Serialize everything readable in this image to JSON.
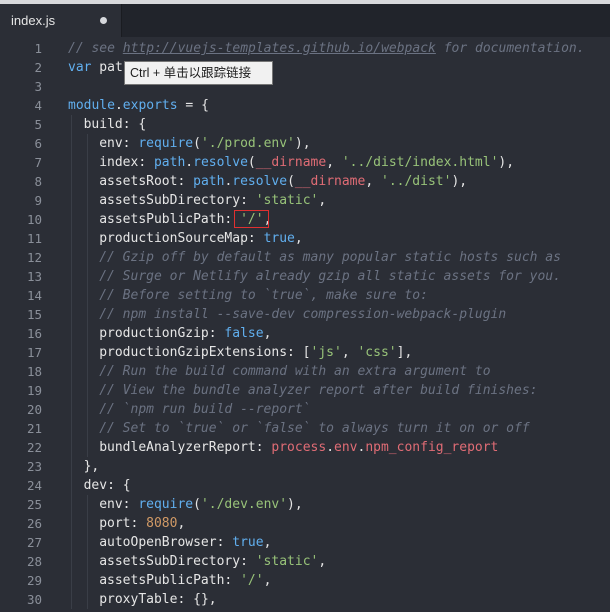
{
  "tab": {
    "title": "index.js",
    "modified": true
  },
  "tooltip": {
    "text": "Ctrl + 单击以跟踪链接"
  },
  "lines": [
    {
      "n": 1,
      "indent": 0,
      "tokens": [
        {
          "c": "cmt",
          "t": "// see "
        },
        {
          "c": "link",
          "t": "http://vuejs-templates.github.io/webpack"
        },
        {
          "c": "cmt",
          "t": " for documentation."
        }
      ]
    },
    {
      "n": 2,
      "indent": 0,
      "tokens": [
        {
          "c": "kw",
          "t": "var"
        },
        {
          "c": "id",
          "t": " pat"
        }
      ]
    },
    {
      "n": 3,
      "indent": 0,
      "tokens": []
    },
    {
      "n": 4,
      "indent": 0,
      "tokens": [
        {
          "c": "kw",
          "t": "module"
        },
        {
          "c": "id",
          "t": "."
        },
        {
          "c": "kw",
          "t": "exports"
        },
        {
          "c": "id",
          "t": " = {"
        }
      ]
    },
    {
      "n": 5,
      "indent": 1,
      "tokens": [
        {
          "c": "prop",
          "t": "build"
        },
        {
          "c": "id",
          "t": ": {"
        }
      ]
    },
    {
      "n": 6,
      "indent": 2,
      "tokens": [
        {
          "c": "prop",
          "t": "env"
        },
        {
          "c": "id",
          "t": ": "
        },
        {
          "c": "fn",
          "t": "require"
        },
        {
          "c": "id",
          "t": "("
        },
        {
          "c": "str",
          "t": "'./prod.env'"
        },
        {
          "c": "id",
          "t": "),"
        }
      ]
    },
    {
      "n": 7,
      "indent": 2,
      "tokens": [
        {
          "c": "prop",
          "t": "index"
        },
        {
          "c": "id",
          "t": ": "
        },
        {
          "c": "kw",
          "t": "path"
        },
        {
          "c": "id",
          "t": "."
        },
        {
          "c": "fn",
          "t": "resolve"
        },
        {
          "c": "id",
          "t": "("
        },
        {
          "c": "special",
          "t": "__dirname"
        },
        {
          "c": "id",
          "t": ", "
        },
        {
          "c": "str",
          "t": "'../dist/index.html'"
        },
        {
          "c": "id",
          "t": "),"
        }
      ]
    },
    {
      "n": 8,
      "indent": 2,
      "tokens": [
        {
          "c": "prop",
          "t": "assetsRoot"
        },
        {
          "c": "id",
          "t": ": "
        },
        {
          "c": "kw",
          "t": "path"
        },
        {
          "c": "id",
          "t": "."
        },
        {
          "c": "fn",
          "t": "resolve"
        },
        {
          "c": "id",
          "t": "("
        },
        {
          "c": "special",
          "t": "__dirname"
        },
        {
          "c": "id",
          "t": ", "
        },
        {
          "c": "str",
          "t": "'../dist'"
        },
        {
          "c": "id",
          "t": "),"
        }
      ]
    },
    {
      "n": 9,
      "indent": 2,
      "tokens": [
        {
          "c": "prop",
          "t": "assetsSubDirectory"
        },
        {
          "c": "id",
          "t": ": "
        },
        {
          "c": "str",
          "t": "'static'"
        },
        {
          "c": "id",
          "t": ","
        }
      ]
    },
    {
      "n": 10,
      "indent": 2,
      "tokens": [
        {
          "c": "prop",
          "t": "assetsPublicPath"
        },
        {
          "c": "id",
          "t": ": "
        },
        {
          "c": "str",
          "t": "'/'"
        },
        {
          "c": "id",
          "t": ","
        }
      ]
    },
    {
      "n": 11,
      "indent": 2,
      "tokens": [
        {
          "c": "prop",
          "t": "productionSourceMap"
        },
        {
          "c": "id",
          "t": ": "
        },
        {
          "c": "kw",
          "t": "true"
        },
        {
          "c": "id",
          "t": ","
        }
      ]
    },
    {
      "n": 12,
      "indent": 2,
      "tokens": [
        {
          "c": "cmt",
          "t": "// Gzip off by default as many popular static hosts such as"
        }
      ]
    },
    {
      "n": 13,
      "indent": 2,
      "tokens": [
        {
          "c": "cmt",
          "t": "// Surge or Netlify already gzip all static assets for you."
        }
      ]
    },
    {
      "n": 14,
      "indent": 2,
      "tokens": [
        {
          "c": "cmt",
          "t": "// Before setting to `true`, make sure to:"
        }
      ]
    },
    {
      "n": 15,
      "indent": 2,
      "tokens": [
        {
          "c": "cmt",
          "t": "// npm install --save-dev compression-webpack-plugin"
        }
      ]
    },
    {
      "n": 16,
      "indent": 2,
      "tokens": [
        {
          "c": "prop",
          "t": "productionGzip"
        },
        {
          "c": "id",
          "t": ": "
        },
        {
          "c": "kw",
          "t": "false"
        },
        {
          "c": "id",
          "t": ","
        }
      ]
    },
    {
      "n": 17,
      "indent": 2,
      "tokens": [
        {
          "c": "prop",
          "t": "productionGzipExtensions"
        },
        {
          "c": "id",
          "t": ": ["
        },
        {
          "c": "str",
          "t": "'js'"
        },
        {
          "c": "id",
          "t": ", "
        },
        {
          "c": "str",
          "t": "'css'"
        },
        {
          "c": "id",
          "t": "],"
        }
      ]
    },
    {
      "n": 18,
      "indent": 2,
      "tokens": [
        {
          "c": "cmt",
          "t": "// Run the build command with an extra argument to"
        }
      ]
    },
    {
      "n": 19,
      "indent": 2,
      "tokens": [
        {
          "c": "cmt",
          "t": "// View the bundle analyzer report after build finishes:"
        }
      ]
    },
    {
      "n": 20,
      "indent": 2,
      "tokens": [
        {
          "c": "cmt",
          "t": "// `npm run build --report`"
        }
      ]
    },
    {
      "n": 21,
      "indent": 2,
      "tokens": [
        {
          "c": "cmt",
          "t": "// Set to `true` or `false` to always turn it on or off"
        }
      ]
    },
    {
      "n": 22,
      "indent": 2,
      "tokens": [
        {
          "c": "prop",
          "t": "bundleAnalyzerReport"
        },
        {
          "c": "id",
          "t": ": "
        },
        {
          "c": "special",
          "t": "process"
        },
        {
          "c": "id",
          "t": "."
        },
        {
          "c": "special",
          "t": "env"
        },
        {
          "c": "id",
          "t": "."
        },
        {
          "c": "special",
          "t": "npm_config_report"
        }
      ]
    },
    {
      "n": 23,
      "indent": 1,
      "tokens": [
        {
          "c": "id",
          "t": "},"
        }
      ]
    },
    {
      "n": 24,
      "indent": 1,
      "tokens": [
        {
          "c": "prop",
          "t": "dev"
        },
        {
          "c": "id",
          "t": ": {"
        }
      ]
    },
    {
      "n": 25,
      "indent": 2,
      "tokens": [
        {
          "c": "prop",
          "t": "env"
        },
        {
          "c": "id",
          "t": ": "
        },
        {
          "c": "fn",
          "t": "require"
        },
        {
          "c": "id",
          "t": "("
        },
        {
          "c": "str",
          "t": "'./dev.env'"
        },
        {
          "c": "id",
          "t": "),"
        }
      ]
    },
    {
      "n": 26,
      "indent": 2,
      "tokens": [
        {
          "c": "prop",
          "t": "port"
        },
        {
          "c": "id",
          "t": ": "
        },
        {
          "c": "num",
          "t": "8080"
        },
        {
          "c": "id",
          "t": ","
        }
      ]
    },
    {
      "n": 27,
      "indent": 2,
      "tokens": [
        {
          "c": "prop",
          "t": "autoOpenBrowser"
        },
        {
          "c": "id",
          "t": ": "
        },
        {
          "c": "kw",
          "t": "true"
        },
        {
          "c": "id",
          "t": ","
        }
      ]
    },
    {
      "n": 28,
      "indent": 2,
      "tokens": [
        {
          "c": "prop",
          "t": "assetsSubDirectory"
        },
        {
          "c": "id",
          "t": ": "
        },
        {
          "c": "str",
          "t": "'static'"
        },
        {
          "c": "id",
          "t": ","
        }
      ]
    },
    {
      "n": 29,
      "indent": 2,
      "tokens": [
        {
          "c": "prop",
          "t": "assetsPublicPath"
        },
        {
          "c": "id",
          "t": ": "
        },
        {
          "c": "str",
          "t": "'/'"
        },
        {
          "c": "id",
          "t": ","
        }
      ]
    },
    {
      "n": 30,
      "indent": 2,
      "tokens": [
        {
          "c": "prop",
          "t": "proxyTable"
        },
        {
          "c": "id",
          "t": ": {},"
        }
      ]
    }
  ]
}
